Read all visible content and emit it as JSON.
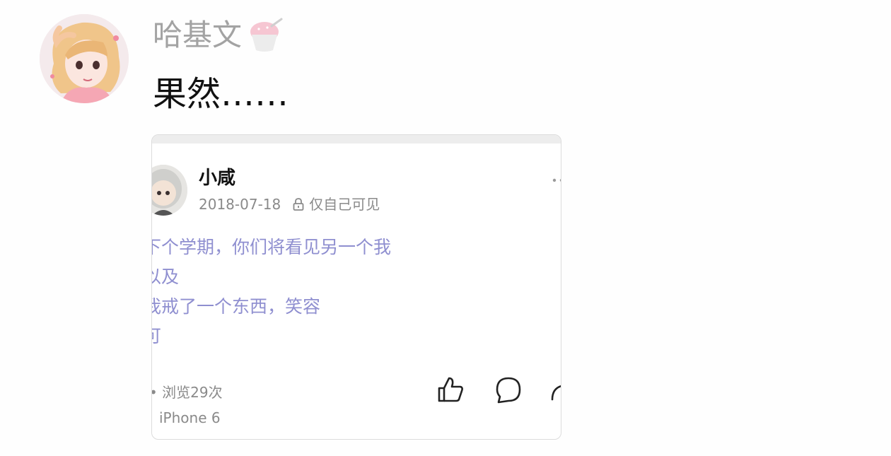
{
  "comment": {
    "author_name": "哈基文",
    "text": "果然……"
  },
  "shared_post": {
    "username": "小咸",
    "date": "2018-07-18",
    "visibility": "仅自己可见",
    "body_lines": [
      "下个学期，你们将看见另一个我",
      "以及",
      "我戒了一个东西，笑容",
      "可"
    ],
    "views": "浏览29次",
    "device": "iPhone 6"
  },
  "icons": {
    "badge": "shaved-ice-icon",
    "visibility": "lock-icon",
    "like": "thumbs-up-icon",
    "comment": "comment-bubble-icon",
    "share": "share-icon",
    "more": "more-dots-icon"
  },
  "colors": {
    "author_name": "#a3a3a3",
    "post_body": "#8f8fd0",
    "meta": "#8a8a8a"
  }
}
